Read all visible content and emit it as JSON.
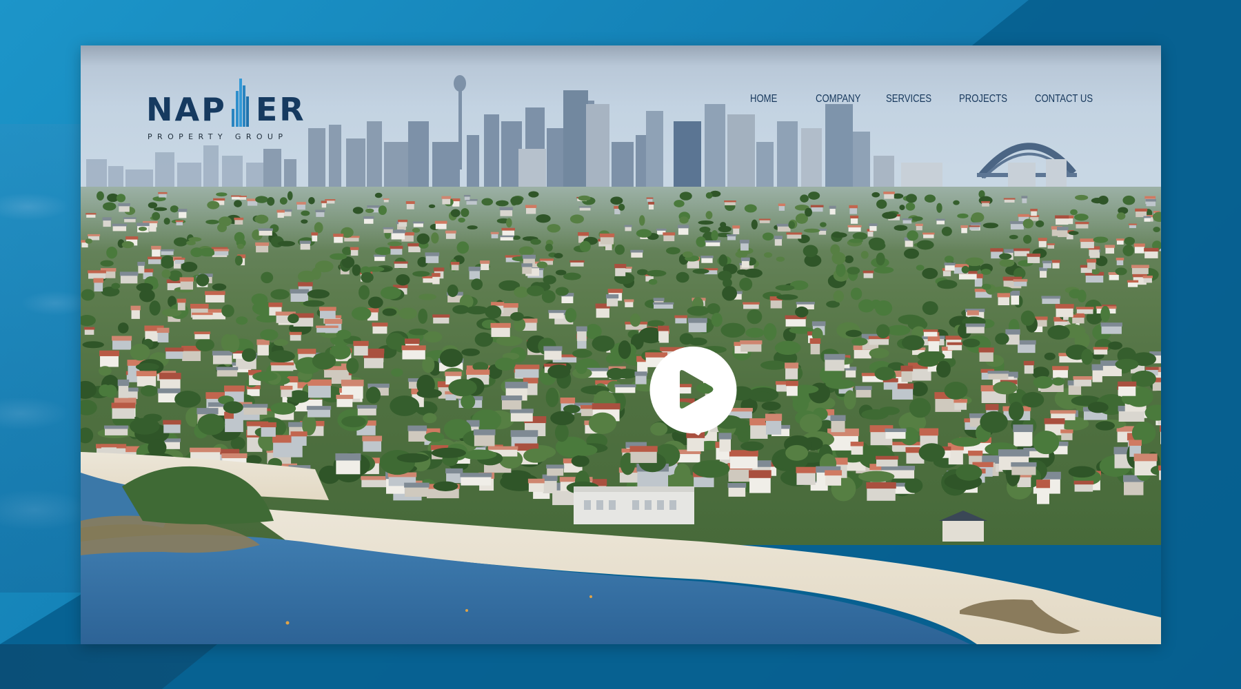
{
  "logo": {
    "name_left": "NAP",
    "name_right": "ER",
    "tagline": "PROPERTY GROUP",
    "brand_color": "#163a60",
    "tower_color": "#2a84c0"
  },
  "nav": {
    "items": [
      {
        "label": "HOME"
      },
      {
        "label": "COMPANY"
      },
      {
        "label": "SERVICES"
      },
      {
        "label": "PROJECTS"
      },
      {
        "label": "CONTACT US"
      }
    ]
  },
  "hero": {
    "description": "Aerial view of a harbourside beach suburb with city skyline and harbour bridge",
    "play_icon": "play-icon"
  },
  "colors": {
    "background_light": "#1c95c9",
    "background_dark": "#07608f",
    "nav_text": "#17385c"
  }
}
